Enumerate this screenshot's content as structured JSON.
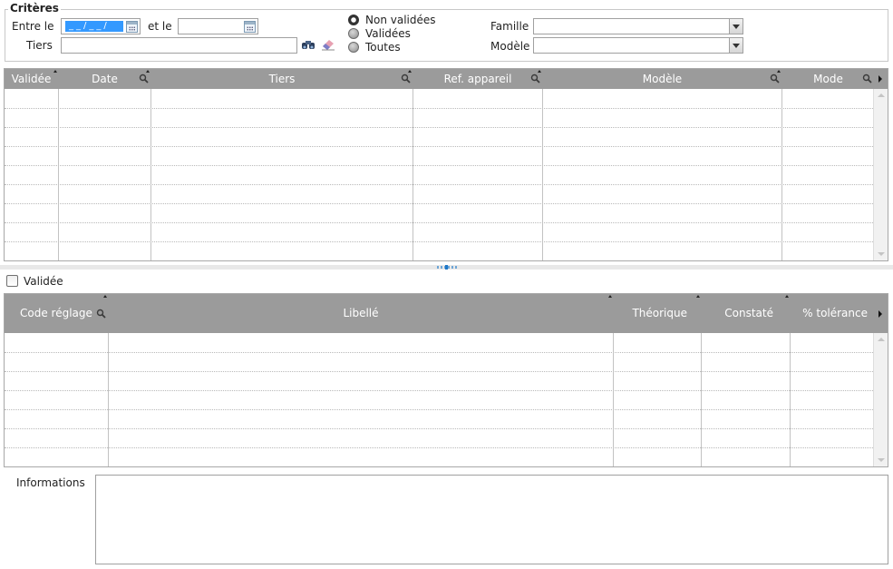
{
  "criteria": {
    "title": "Critères",
    "entre_le_label": "Entre le",
    "date_from_value": "__/__/",
    "et_le_label": "et le",
    "date_to_value": "",
    "tiers_label": "Tiers",
    "tiers_value": "",
    "status_options": [
      {
        "label": "Non validées",
        "checked": true
      },
      {
        "label": "Validées",
        "checked": false
      },
      {
        "label": "Toutes",
        "checked": false
      }
    ],
    "famille_label": "Famille",
    "famille_value": "",
    "modele_label": "Modèle",
    "modele_value": ""
  },
  "main_table": {
    "columns": [
      {
        "label": "Validée"
      },
      {
        "label": "Date"
      },
      {
        "label": "Tiers"
      },
      {
        "label": "Ref. appareil"
      },
      {
        "label": "Modèle"
      },
      {
        "label": "Mode"
      }
    ],
    "row_count": 9
  },
  "validated_checkbox": {
    "label": "Validée",
    "checked": false
  },
  "detail_table": {
    "columns": [
      {
        "label": "Code réglage"
      },
      {
        "label": "Libellé"
      },
      {
        "label": "Théorique"
      },
      {
        "label": "Constaté"
      },
      {
        "label": "% tolérance"
      }
    ],
    "row_count": 7
  },
  "informations": {
    "label": "Informations",
    "value": ""
  },
  "icons": {
    "calendar": "calendar-icon",
    "search": "magnifier-icon",
    "binoculars": "binoculars-icon",
    "eraser": "eraser-icon"
  }
}
